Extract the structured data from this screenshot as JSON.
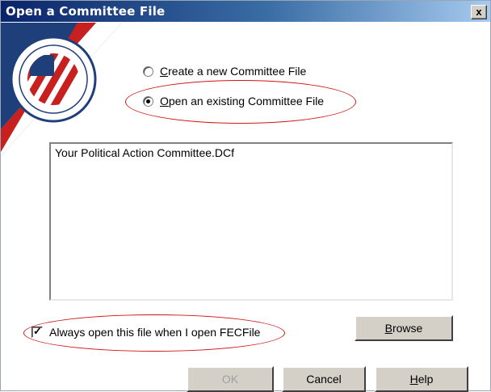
{
  "window": {
    "title": "Open a Committee File",
    "close_label": "x"
  },
  "options": {
    "create_new": {
      "label": "Create a new Committee File",
      "mnemonic": "C",
      "rest": "reate a new Committee File",
      "selected": false
    },
    "open_existing": {
      "label": "Open an existing Committee File",
      "mnemonic": "O",
      "rest": "pen an existing Committee File",
      "selected": true
    }
  },
  "file_list": {
    "items": [
      "Your Political Action Committee.DCf"
    ]
  },
  "always_open": {
    "label": "Always open this file when I open FECFile",
    "checked": true
  },
  "buttons": {
    "browse": {
      "label": "Browse",
      "mnemonic": "B",
      "rest": "rowse"
    },
    "ok": {
      "label": "OK"
    },
    "cancel": {
      "label": "Cancel"
    },
    "help": {
      "label": "Help",
      "mnemonic": "H",
      "rest": "elp"
    }
  },
  "colors": {
    "title_gradient_start": "#0a246a",
    "title_gradient_end": "#a6caf0",
    "annotation": "#d01414",
    "seal_red": "#c8201e",
    "seal_blue": "#1f3f7a"
  }
}
